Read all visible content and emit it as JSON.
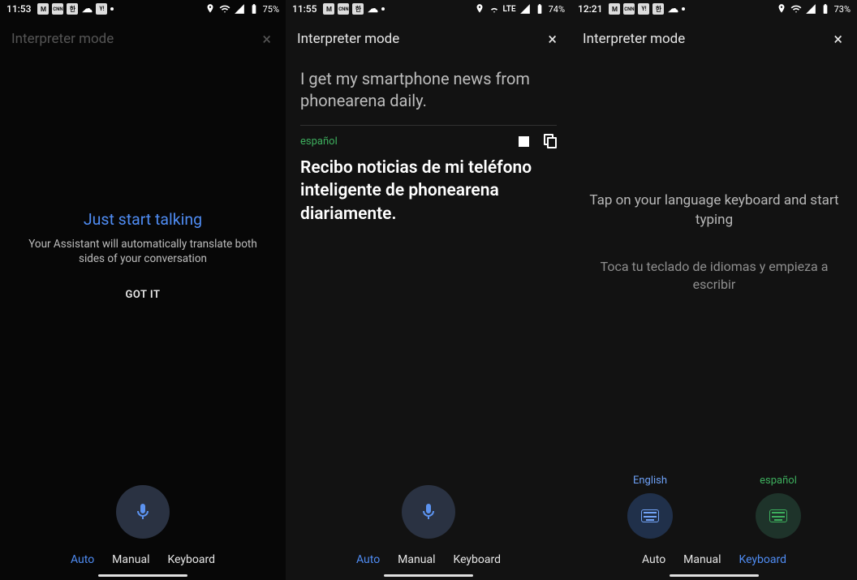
{
  "screen1": {
    "status": {
      "time": "11:53",
      "battery": "75%"
    },
    "header": {
      "title": "Interpreter mode"
    },
    "intro": {
      "title": "Just start talking",
      "subtitle": "Your Assistant will automatically translate both sides of your conversation",
      "button": "GOT IT"
    },
    "tabs": {
      "auto": "Auto",
      "manual": "Manual",
      "keyboard": "Keyboard",
      "active": "auto"
    }
  },
  "screen2": {
    "status": {
      "time": "11:55",
      "network": "LTE",
      "battery": "74%"
    },
    "header": {
      "title": "Interpreter mode"
    },
    "source": {
      "text": "I get my smartphone news from phonearena daily."
    },
    "target": {
      "lang_label": "español",
      "text": "Recibo noticias de mi teléfono inteligente de phonearena diariamente."
    },
    "tabs": {
      "auto": "Auto",
      "manual": "Manual",
      "keyboard": "Keyboard",
      "active": "auto"
    }
  },
  "screen3": {
    "status": {
      "time": "12:21",
      "battery": "73%"
    },
    "header": {
      "title": "Interpreter mode"
    },
    "hint_en": "Tap on your language keyboard and start typing",
    "hint_es": "Toca tu teclado de idiomas y empieza a escribir",
    "keyboards": {
      "en_label": "English",
      "es_label": "español"
    },
    "tabs": {
      "auto": "Auto",
      "manual": "Manual",
      "keyboard": "Keyboard",
      "active": "keyboard"
    }
  },
  "icons": {
    "close": "×",
    "gmail": "M",
    "cnn": "CNN",
    "lang": "한",
    "yahoo": "Y!",
    "cloud": "☁"
  }
}
